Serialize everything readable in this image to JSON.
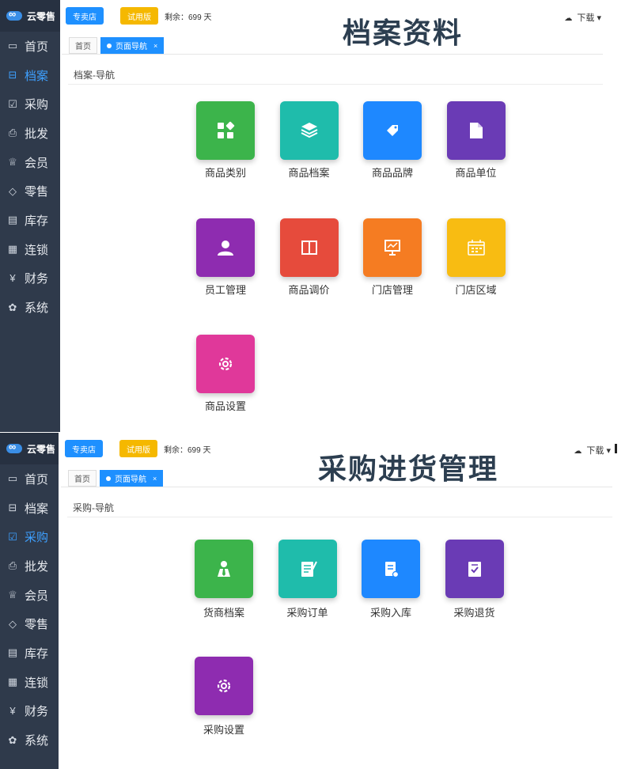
{
  "app": {
    "name": "云零售"
  },
  "topbar": {
    "store_btn": "专卖店",
    "trial_btn": "试用版",
    "remain": "剩余：699 天",
    "download": "下载"
  },
  "sidebar": {
    "items": [
      {
        "label": "首页",
        "icon": "monitor-icon"
      },
      {
        "label": "档案",
        "icon": "archive-icon"
      },
      {
        "label": "采购",
        "icon": "clipboard-icon"
      },
      {
        "label": "批发",
        "icon": "printer-icon"
      },
      {
        "label": "会员",
        "icon": "crown-icon"
      },
      {
        "label": "零售",
        "icon": "tag-icon"
      },
      {
        "label": "库存",
        "icon": "box-icon"
      },
      {
        "label": "连锁",
        "icon": "store-icon"
      },
      {
        "label": "财务",
        "icon": "yen-icon"
      },
      {
        "label": "系统",
        "icon": "gear-icon"
      }
    ]
  },
  "tabs": {
    "home": "首页",
    "nav": "页面导航",
    "close": "×"
  },
  "archive": {
    "heading": "档案资料",
    "section": "档案-导航",
    "active_index": 1,
    "tiles": [
      {
        "label": "商品类别",
        "color": "#3cb44b",
        "icon": "category-icon"
      },
      {
        "label": "商品档案",
        "color": "#1fbcab",
        "icon": "layers-icon"
      },
      {
        "label": "商品品牌",
        "color": "#1e88ff",
        "icon": "tag-icon"
      },
      {
        "label": "商品单位",
        "color": "#6a3bb5",
        "icon": "document-icon"
      },
      {
        "label": "员工管理",
        "color": "#8e2cb0",
        "icon": "user-icon"
      },
      {
        "label": "商品调价",
        "color": "#e64b3c",
        "icon": "columns-icon"
      },
      {
        "label": "门店管理",
        "color": "#f57c22",
        "icon": "chart-icon"
      },
      {
        "label": "门店区域",
        "color": "#f8bc12",
        "icon": "calendar-icon"
      },
      {
        "label": "商品设置",
        "color": "#e0389a",
        "icon": "gear-icon"
      }
    ]
  },
  "purchase": {
    "heading": "采购进货管理",
    "section": "采购-导航",
    "active_index": 2,
    "tiles": [
      {
        "label": "货商档案",
        "color": "#3cb44b",
        "icon": "person-tie-icon"
      },
      {
        "label": "采购订单",
        "color": "#1fbcab",
        "icon": "order-icon"
      },
      {
        "label": "采购入库",
        "color": "#1e88ff",
        "icon": "doc-in-icon"
      },
      {
        "label": "采购退货",
        "color": "#6a3bb5",
        "icon": "return-icon"
      },
      {
        "label": "采购设置",
        "color": "#8e2cb0",
        "icon": "gear-icon"
      }
    ]
  }
}
